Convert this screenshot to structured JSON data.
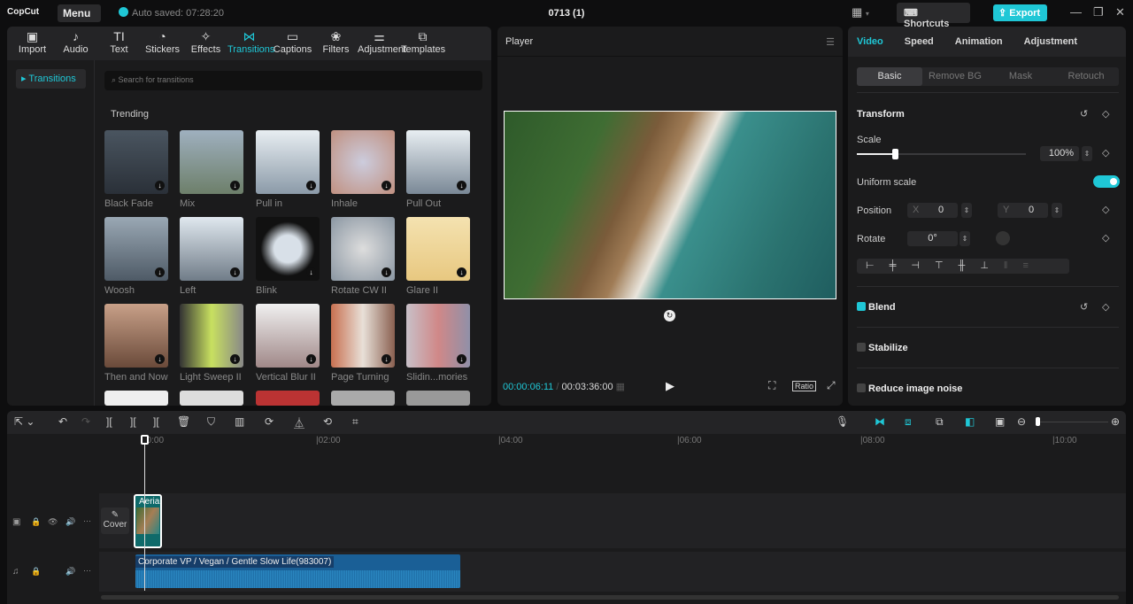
{
  "app": {
    "logo": "CopCut",
    "menu": "Menu",
    "autosave": "Auto saved: 07:28:20",
    "project": "0713 (1)",
    "shortcuts": "Shortcuts",
    "export": "Export"
  },
  "toolbar": [
    {
      "icon": "import-icon",
      "label": "Import",
      "g": "▣"
    },
    {
      "icon": "audio-icon",
      "label": "Audio",
      "g": "♪"
    },
    {
      "icon": "text-icon",
      "label": "Text",
      "g": "TI"
    },
    {
      "icon": "stickers-icon",
      "label": "Stickers",
      "g": "◔"
    },
    {
      "icon": "effects-icon",
      "label": "Effects",
      "g": "✧"
    },
    {
      "icon": "transitions-icon",
      "label": "Transitions",
      "g": "⋈"
    },
    {
      "icon": "captions-icon",
      "label": "Captions",
      "g": "▭"
    },
    {
      "icon": "filters-icon",
      "label": "Filters",
      "g": "❀"
    },
    {
      "icon": "adjustment-icon",
      "label": "Adjustment",
      "g": "⚌"
    },
    {
      "icon": "templates-icon",
      "label": "Templates",
      "g": "⧉"
    }
  ],
  "sidebar": {
    "item": "Transitions"
  },
  "search": {
    "placeholder": "Search for transitions"
  },
  "section": "Trending",
  "transitions": [
    {
      "label": "Black Fade",
      "color": "linear-gradient(#4a5560,#2a3038)"
    },
    {
      "label": "Mix",
      "color": "linear-gradient(#9fb0bf,#6d7f6a)"
    },
    {
      "label": "Pull in",
      "color": "linear-gradient(#e8eef2,#8b9aa8)"
    },
    {
      "label": "Inhale",
      "color": "radial-gradient(#ccd,#c09080)"
    },
    {
      "label": "Pull Out",
      "color": "linear-gradient(#e8eef2,#7a8896)"
    },
    {
      "label": "Woosh",
      "color": "linear-gradient(#9aa8b4,#4e5a66)"
    },
    {
      "label": "Left",
      "color": "linear-gradient(#e0e8ef,#707c88)"
    },
    {
      "label": "Blink",
      "color": "radial-gradient(#d8e0e8 30%,#111 60%)"
    },
    {
      "label": "Rotate CW II",
      "color": "radial-gradient(#ddd,#8a96a2)"
    },
    {
      "label": "Glare II",
      "color": "linear-gradient(#f4e2b0,#e8c880)"
    },
    {
      "label": "Then and Now",
      "color": "linear-gradient(#c8a088,#6a4a3a)"
    },
    {
      "label": "Light Sweep II",
      "color": "linear-gradient(90deg,#333,#c8e060,#888)"
    },
    {
      "label": "Vertical Blur II",
      "color": "linear-gradient(#f0f0f0,#a08888)"
    },
    {
      "label": "Page Turning",
      "color": "linear-gradient(90deg,#c87050,#e8e0d8,#8a6050)"
    },
    {
      "label": "Slidin...mories",
      "color": "linear-gradient(90deg,#c8c0c8,#d08888,#9090a8)"
    }
  ],
  "player": {
    "title": "Player",
    "current": "00:00:06:11",
    "total": "00:03:36:00",
    "ratio": "Ratio"
  },
  "inspector": {
    "tabs": [
      "Video",
      "Speed",
      "Animation",
      "Adjustment"
    ],
    "subtabs": [
      "Basic",
      "Remove BG",
      "Mask",
      "Retouch"
    ],
    "transform": "Transform",
    "scale_label": "Scale",
    "scale": "100%",
    "scale_value": 0.07,
    "uniform": "Uniform scale",
    "uniform_on": true,
    "position": "Position",
    "x_label": "X",
    "x": "0",
    "y_label": "Y",
    "y": "0",
    "rotate": "Rotate",
    "rotate_val": "0°",
    "blend": "Blend",
    "stabilize": "Stabilize",
    "noise": "Reduce image noise"
  },
  "timeline": {
    "ticks": [
      "00:00",
      "|02:00",
      "|04:00",
      "|06:00",
      "|08:00",
      "|10:00"
    ],
    "cover": "Cover",
    "clip": "Aerial",
    "audio": "Corporate VP / Vegan / Gentle Slow Life(983007)"
  },
  "accent": "#1fc7d6"
}
